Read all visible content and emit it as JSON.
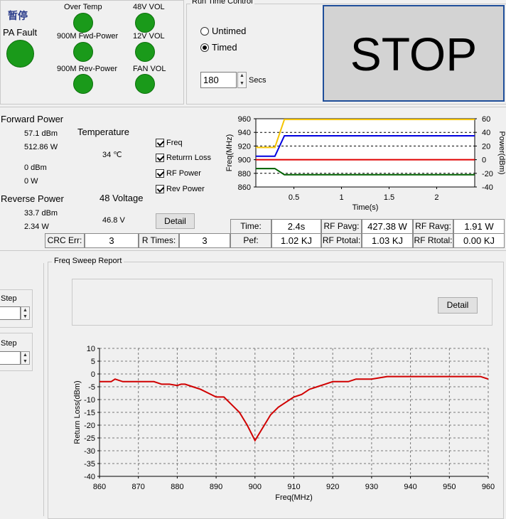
{
  "status": {
    "pause_label": "暂停",
    "pa_fault_label": "PA Fault",
    "indicators": [
      {
        "label": "Over Temp"
      },
      {
        "label": "48V VOL"
      },
      {
        "label": "900M Fwd-Power"
      },
      {
        "label": "12V VOL"
      },
      {
        "label": "900M Rev-Power"
      },
      {
        "label": "FAN VOL"
      }
    ],
    "led_color": "#1a9a1a"
  },
  "run_control": {
    "title": "Run Time Control",
    "untimed_label": "Untimed",
    "timed_label": "Timed",
    "selected": "Timed",
    "secs_value": "180",
    "secs_label": "Secs",
    "stop_label": "STOP"
  },
  "readings": {
    "forward_power_label": "Forward Power",
    "fwd_dbm": "57.1 dBm",
    "fwd_w": "512.86 W",
    "zero_dbm": "0 dBm",
    "zero_w": "0 W",
    "reverse_power_label": "Reverse Power",
    "rev_dbm": "33.7 dBm",
    "rev_w": "2.34 W",
    "temperature_label": "Temperature",
    "temperature_value": "34 ℃",
    "voltage_label": "48 Voltage",
    "voltage_value": "46.8 V",
    "checkboxes": [
      "Freq",
      "Returrn Loss",
      "RF Power",
      "Rev Power"
    ],
    "detail_label": "Detail"
  },
  "stats": {
    "time_label": "Time:",
    "time_value": "2.4s",
    "rf_pavg_label": "RF Pavg:",
    "rf_pavg_value": "427.38 W",
    "rf_ravg_label": "RF Ravg:",
    "rf_ravg_value": "1.91 W",
    "crc_label": "CRC Err:",
    "crc_value": "3",
    "rtimes_label": "R Times:",
    "rtimes_value": "3",
    "pef_label": "Pef:",
    "pef_value": "1.02 KJ",
    "rf_ptotal_label": "RF Ptotal:",
    "rf_ptotal_value": "1.03 KJ",
    "rf_rtotal_label": "RF Rtotal:",
    "rf_rtotal_value": "0.00 KJ"
  },
  "side": {
    "step_label_1": "Step",
    "step_label_2": "Step"
  },
  "sweep": {
    "title": "Freq Sweep Report",
    "detail_label": "Detail"
  },
  "chart_data": [
    {
      "type": "line",
      "xlabel": "Time(s)",
      "ylabel": "Freq(MHz)",
      "y2label": "Power(dBm)",
      "xlim": [
        0.1,
        2.4
      ],
      "ylim": [
        860,
        960
      ],
      "y2lim": [
        -40,
        60
      ],
      "xticks": [
        "0.5",
        "1",
        "1.5",
        "2"
      ],
      "yticks": [
        "960",
        "940",
        "920",
        "900",
        "880",
        "860"
      ],
      "y2ticks": [
        "60",
        "40",
        "20",
        "0",
        "-20",
        "-40"
      ],
      "grid": true,
      "series": [
        {
          "color": "#f5c400",
          "axis": "y",
          "x": [
            0.1,
            0.3,
            0.4,
            2.4
          ],
          "y": [
            918,
            918,
            959,
            959
          ]
        },
        {
          "color": "#0000e0",
          "axis": "y",
          "x": [
            0.1,
            0.3,
            0.4,
            2.4
          ],
          "y": [
            905,
            905,
            935,
            935
          ]
        },
        {
          "color": "#e00000",
          "axis": "y2",
          "x": [
            0.1,
            2.4
          ],
          "y": [
            0,
            0
          ]
        },
        {
          "color": "#006000",
          "axis": "y2",
          "x": [
            0.1,
            0.3,
            0.4,
            2.4
          ],
          "y": [
            -13,
            -13,
            -22,
            -22
          ]
        }
      ]
    },
    {
      "type": "line",
      "xlabel": "Freq(MHz)",
      "ylabel": "Return Loss(dBm)",
      "xlim": [
        860,
        960
      ],
      "ylim": [
        -40,
        10
      ],
      "xticks": [
        "860",
        "870",
        "880",
        "890",
        "900",
        "910",
        "920",
        "930",
        "940",
        "950",
        "960"
      ],
      "yticks": [
        "10",
        "5",
        "0",
        "-5",
        "-10",
        "-15",
        "-20",
        "-25",
        "-30",
        "-35",
        "-40"
      ],
      "grid": true,
      "series": [
        {
          "color": "#d00000",
          "x": [
            860,
            863,
            864,
            866,
            870,
            874,
            876,
            878,
            880,
            881,
            882,
            884,
            886,
            888,
            890,
            892,
            894,
            896,
            898,
            900,
            902,
            904,
            906,
            908,
            910,
            912,
            914,
            916,
            918,
            920,
            924,
            926,
            930,
            934,
            940,
            946,
            952,
            956,
            958,
            960
          ],
          "y": [
            -3,
            -3,
            -2,
            -3,
            -3,
            -3,
            -4,
            -4,
            -4.5,
            -4,
            -4,
            -5,
            -6,
            -7.5,
            -9,
            -9,
            -12,
            -15,
            -20,
            -26,
            -21,
            -16,
            -13,
            -11,
            -9,
            -8,
            -6,
            -5,
            -4,
            -3,
            -3,
            -2,
            -2,
            -1,
            -1,
            -1,
            -1,
            -1,
            -1,
            -2
          ]
        }
      ]
    }
  ]
}
